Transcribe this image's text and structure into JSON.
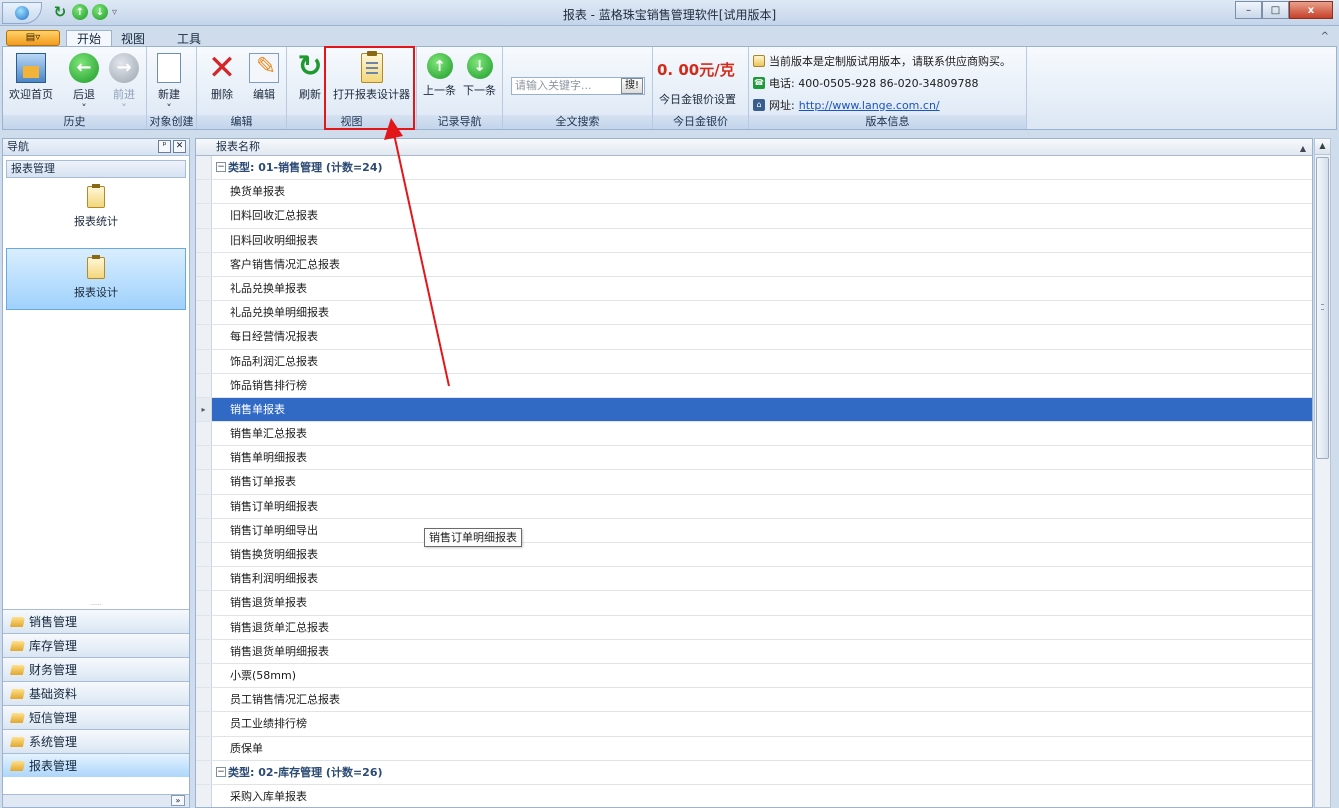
{
  "window": {
    "title": "报表 - 蓝格珠宝销售管理软件[试用版本]",
    "minimize": "–",
    "maximize": "□",
    "close": "x"
  },
  "ribbon_tabs": {
    "app_menu": "▤▿",
    "tabs": [
      "开始",
      "视图",
      "工具"
    ],
    "active": "开始",
    "collapse": "^"
  },
  "ribbon": {
    "history": {
      "label": "历史",
      "home": "欢迎首页",
      "back": "后退",
      "forward": "前进",
      "back_caret": "˅",
      "forward_caret": "˅"
    },
    "create": {
      "label": "对象创建",
      "new": "新建",
      "new_caret": "˅"
    },
    "edit": {
      "label": "编辑",
      "delete": "删除",
      "edit": "编辑"
    },
    "view": {
      "label": "视图",
      "refresh": "刷新",
      "open_designer": "打开报表设计器"
    },
    "record_nav": {
      "label": "记录导航",
      "prev": "上一条",
      "next": "下一条"
    },
    "fulltext": {
      "label": "全文搜索",
      "placeholder": "请输入关键字...",
      "search_button": "搜!"
    },
    "gold_price": {
      "label": "今日金银价",
      "price": "0. 00元/克",
      "setting": "今日金银价设置"
    },
    "version": {
      "label": "版本信息",
      "notice": "当前版本是定制版试用版本，请联系供应商购买。",
      "phone": "电话:  400-0505-928  86-020-34809788",
      "website_label": "网址:",
      "website": "http://www.lange.com.cn/"
    }
  },
  "nav": {
    "title": "导航",
    "pin": "ᵖ",
    "close": "✕",
    "group": "报表管理",
    "items": [
      {
        "label": "报表统计",
        "active": false
      },
      {
        "label": "报表设计",
        "active": true
      }
    ],
    "splitter": "......",
    "modules": [
      {
        "label": "销售管理",
        "active": false
      },
      {
        "label": "库存管理",
        "active": false
      },
      {
        "label": "财务管理",
        "active": false
      },
      {
        "label": "基础资料",
        "active": false
      },
      {
        "label": "短信管理",
        "active": false
      },
      {
        "label": "系统管理",
        "active": false
      },
      {
        "label": "报表管理",
        "active": true
      }
    ],
    "footer_button": "»"
  },
  "grid": {
    "column_header": "报表名称",
    "groups": [
      {
        "title": "类型: 01-销售管理 (计数=24)",
        "rows": [
          "换货单报表",
          "旧料回收汇总报表",
          "旧料回收明细报表",
          "客户销售情况汇总报表",
          "礼品兑换单报表",
          "礼品兑换单明细报表",
          "每日经营情况报表",
          "饰品利润汇总报表",
          "饰品销售排行榜",
          "销售单报表",
          "销售单汇总报表",
          "销售单明细报表",
          "销售订单报表",
          "销售订单明细报表",
          "销售订单明细导出",
          "销售换货明细报表",
          "销售利润明细报表",
          "销售退货单报表",
          "销售退货单汇总报表",
          "销售退货单明细报表",
          "小票(58mm)",
          "员工销售情况汇总报表",
          "员工业绩排行榜",
          "质保单"
        ]
      },
      {
        "title": "类型: 02-库存管理 (计数=26)",
        "rows": [
          "采购入库单报表"
        ]
      }
    ],
    "selected": "销售单报表",
    "tooltip": "销售订单明细报表"
  },
  "colors": {
    "selection": "#316ac5",
    "highlight": "#e3161a",
    "price": "#d32a1a"
  }
}
